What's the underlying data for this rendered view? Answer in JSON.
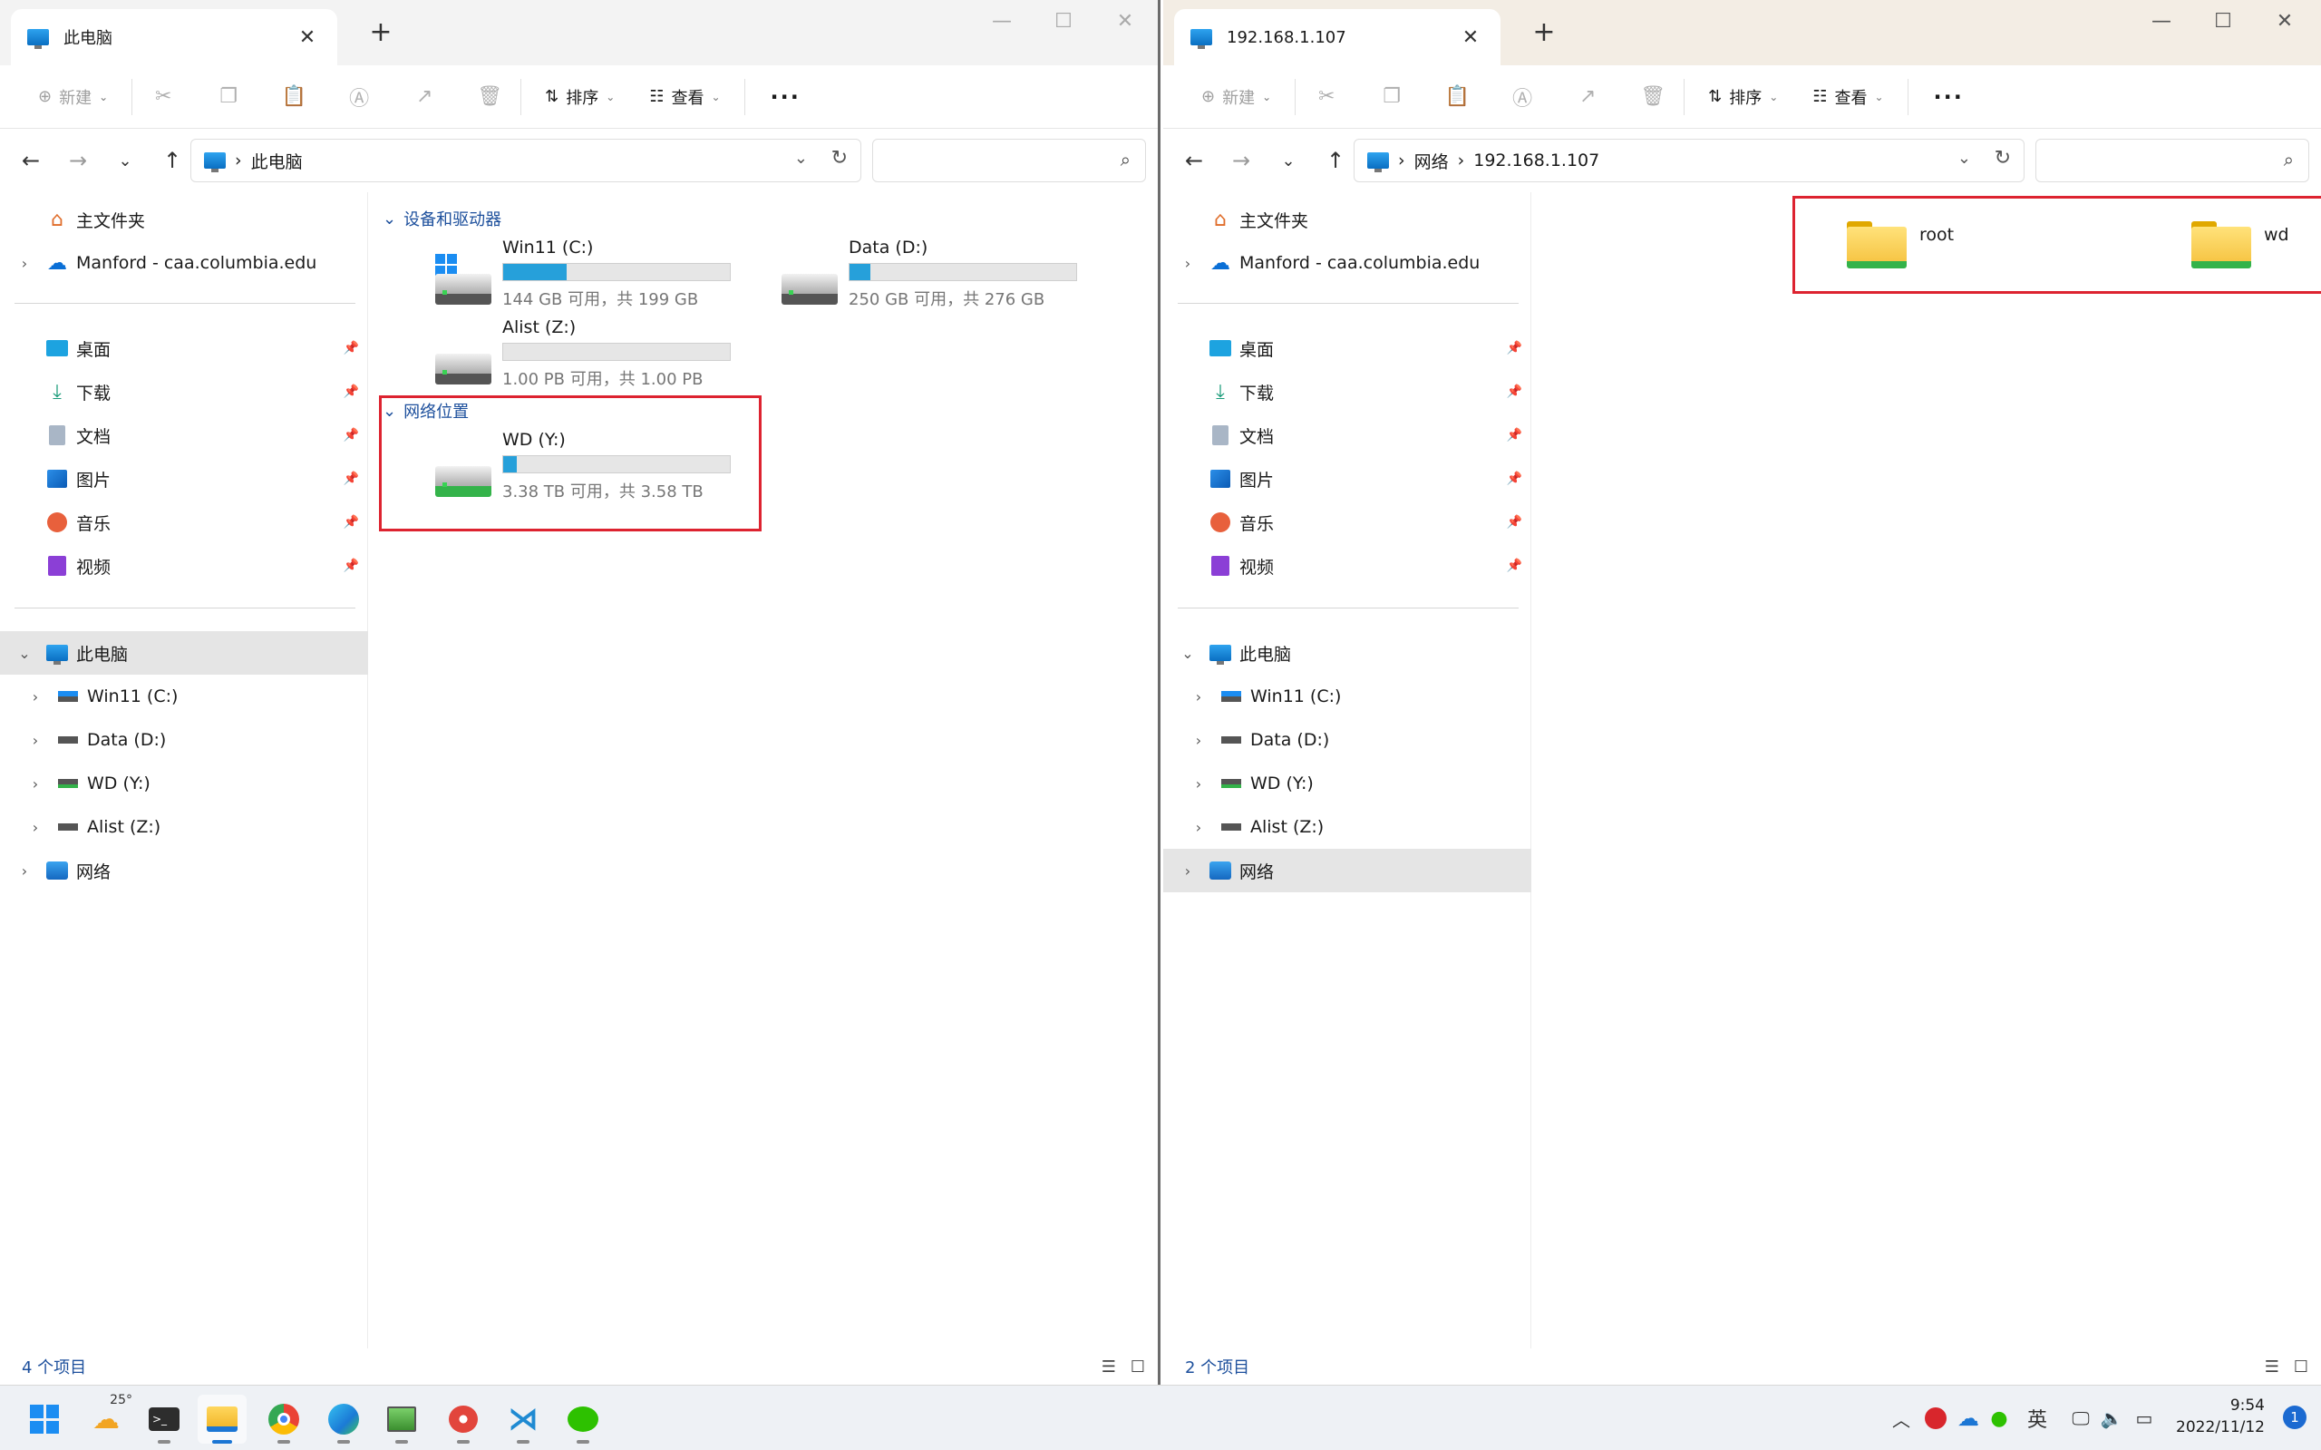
{
  "left_window": {
    "tab_title": "此电脑",
    "toolbar": {
      "new_label": "新建",
      "sort_label": "排序",
      "view_label": "查看"
    },
    "address": {
      "segments": [
        "此电脑"
      ]
    },
    "groups": {
      "devices": "设备和驱动器",
      "network": "网络位置"
    },
    "drives": [
      {
        "name": "Win11 (C:)",
        "capacity": "144 GB 可用，共 199 GB",
        "used_fraction": 0.28
      },
      {
        "name": "Data (D:)",
        "capacity": "250 GB 可用，共 276 GB",
        "used_fraction": 0.09
      },
      {
        "name": "Alist (Z:)",
        "capacity": "1.00 PB 可用，共 1.00 PB",
        "used_fraction": 0.0
      }
    ],
    "network_drives": [
      {
        "name": "WD (Y:)",
        "capacity": "3.38 TB 可用，共 3.58 TB",
        "used_fraction": 0.06
      }
    ],
    "status": "4 个项目"
  },
  "right_window": {
    "tab_title": "192.168.1.107",
    "toolbar": {
      "new_label": "新建",
      "sort_label": "排序",
      "view_label": "查看"
    },
    "address": {
      "segments": [
        "网络",
        "192.168.1.107"
      ]
    },
    "folders": [
      {
        "name": "root"
      },
      {
        "name": "wd"
      }
    ],
    "status": "2 个项目"
  },
  "sidebar": {
    "home": "主文件夹",
    "onedrive": "Manford - caa.columbia.edu",
    "quick": [
      "桌面",
      "下载",
      "文档",
      "图片",
      "音乐",
      "视频"
    ],
    "this_pc": "此电脑",
    "drives": [
      "Win11 (C:)",
      "Data (D:)",
      "WD (Y:)",
      "Alist (Z:)"
    ],
    "network": "网络"
  },
  "taskbar": {
    "weather_temp": "25°",
    "ime": "英",
    "time": "9:54",
    "date": "2022/11/12",
    "notification_count": "1"
  },
  "colors": {
    "accent": "#26a0da",
    "highlight_box": "#dd2330",
    "group_header": "#1c4f9c"
  }
}
